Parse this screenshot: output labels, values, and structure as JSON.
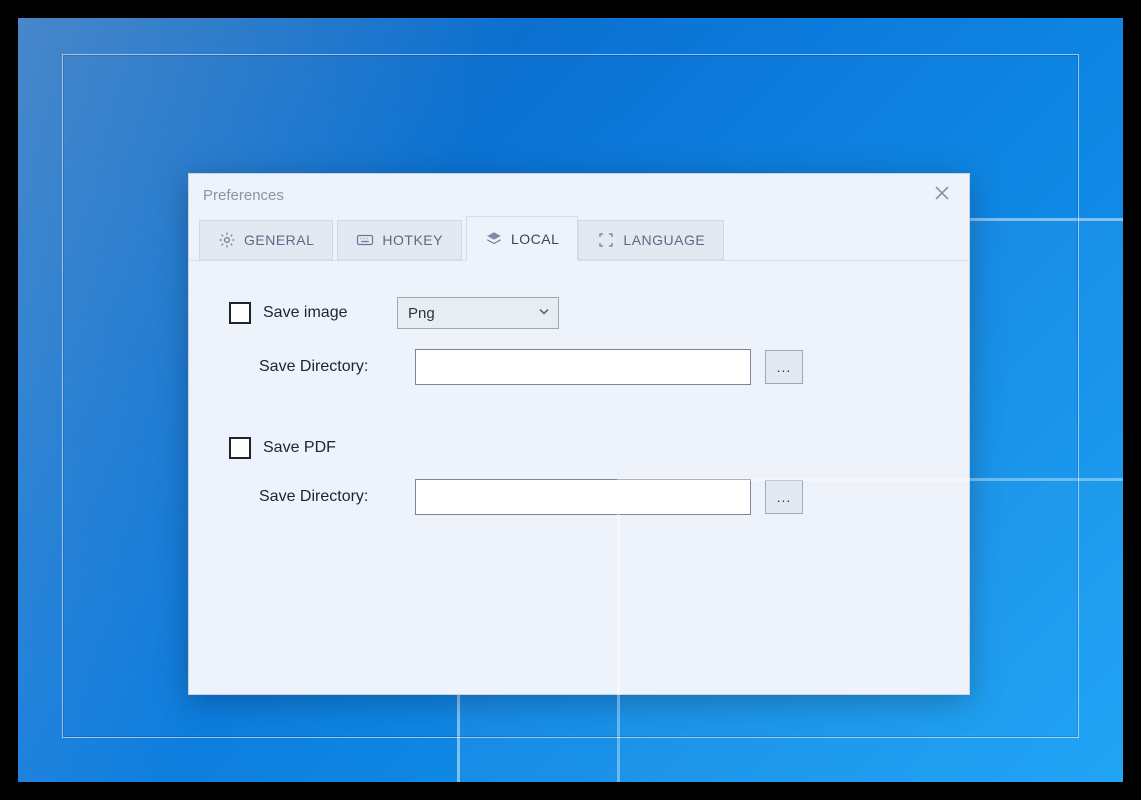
{
  "dialog": {
    "title": "Preferences",
    "tabs": {
      "general": "GENERAL",
      "hotkey": "HOTKEY",
      "local": "LOCAL",
      "language": "LANGUAGE"
    },
    "local": {
      "save_image_label": "Save image",
      "save_image_checked": false,
      "format_selected": "Png",
      "save_image_dir_label": "Save Directory:",
      "save_image_dir_value": "",
      "browse_label": "...",
      "save_pdf_label": "Save PDF",
      "save_pdf_checked": false,
      "save_pdf_dir_label": "Save Directory:",
      "save_pdf_dir_value": ""
    }
  }
}
